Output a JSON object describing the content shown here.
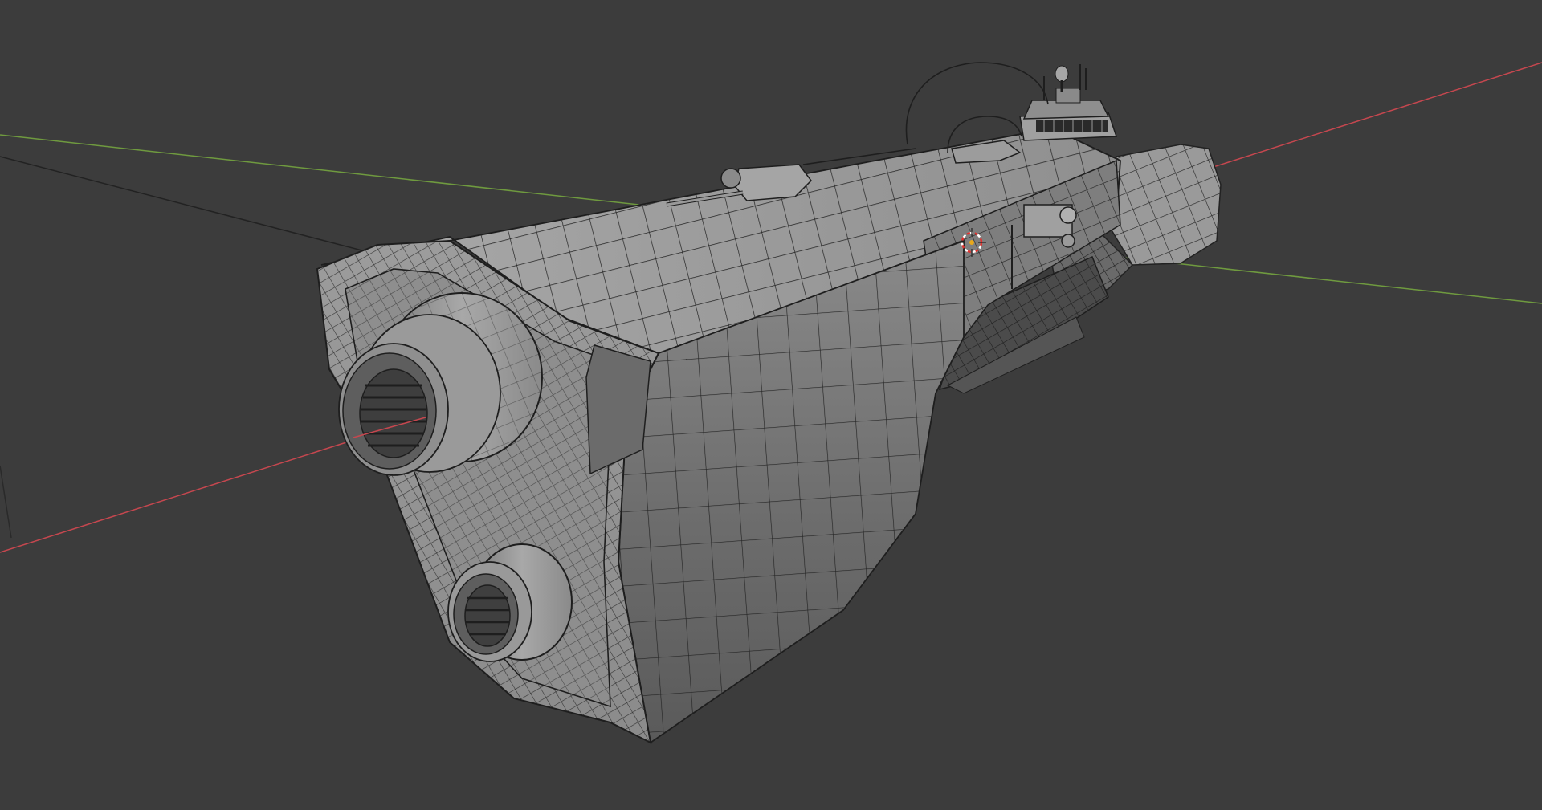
{
  "viewport": {
    "background": "#3c3c3c",
    "x_axis_color": "#c6474f",
    "y_axis_color": "#6f9a3f",
    "wire_color": "#1e1e1e",
    "hull_light": "#a3a3a3",
    "hull_mid": "#8a8a8a",
    "hull_dark": "#5f5f5f",
    "cursor_color": "#e0322f"
  },
  "icons": {
    "cursor": "3d-cursor-icon"
  }
}
